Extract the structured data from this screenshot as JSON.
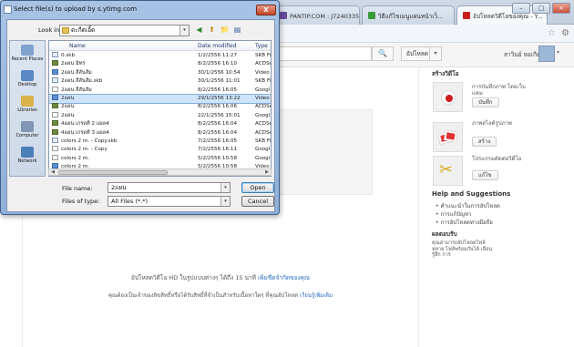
{
  "browser": {
    "tabs": [
      {
        "label": "PANTIP.COM : J7240335 ...",
        "icon_color": "#6b4ea0"
      },
      {
        "label": "วิธีแก้ไขเมนูแผ่นหน้าเว็...",
        "icon_color": "#3a9a3a"
      },
      {
        "label": "อัปโหลดวิดีโอของคุณ - Y...",
        "icon_color": "#cc1c1c"
      }
    ],
    "tab_close": "×",
    "win_min": "–",
    "win_max": "□",
    "win_close": "×",
    "star_icon": "☆",
    "wrench_icon": "⚙"
  },
  "youtube": {
    "search_button": "🔍",
    "upload_label": "อัปโหลด",
    "upload_dropdown": "▾",
    "username": "สาวินย์ หอเกียรติ",
    "avatar_dropdown": "▾",
    "footer_line1": "อัปโหลดวิดีโอ HD ในรูปแบบต่างๆ ได้ถึง 15 นาที",
    "footer_link1": "เพิ่มขีดจำกัดของคุณ",
    "footer_line2": "คุณต้องเป็นเจ้าของลิขสิทธิ์หรือได้รับสิทธิ์ที่จำเป็นสำหรับเนื้อหาใดๆ ที่คุณอัปโหลด",
    "footer_link2": "เรียนรู้เพิ่มเติม",
    "side": {
      "create_title": "สร้างวิดีโอ",
      "record_label": "การบันทึกภาพ โดยเว็บแคม",
      "record_button": "บันทึก",
      "photo_label": "ภาพสไลด์รูปภาพ",
      "photo_button": "สร้าง",
      "edit_label": "โปรแกรมตัดต่อวิดีโอ",
      "edit_button": "แก้ไข",
      "help_title": "Help and Suggestions",
      "help_items": [
        "คำแนะนำในการอัปโหลด",
        "การแก้ปัญหา",
        "การอัปโหลดทางมือถือ"
      ],
      "feedback_title": "ผลตอบรับ",
      "feedback_text": "คุณสามารถอัปโหลดไฟล์หลาย ไฟล์พร้อมกันได้ เลือนรู้สึก การ"
    }
  },
  "dialog": {
    "title": "Select file(s) to upload by s.ytimg.com",
    "close": "X",
    "look_in_label": "Look in:",
    "look_in_value": "ตะกีดเอิ้ด",
    "look_in_dropdown": "▾",
    "toolbar_icons": [
      "◀",
      "⬆",
      "📁",
      "▤"
    ],
    "places": [
      {
        "label": "Recent Places",
        "color": "#7fa3cf"
      },
      {
        "label": "Desktop",
        "color": "#5a88c2"
      },
      {
        "label": "Libraries",
        "color": "#d9b24a"
      },
      {
        "label": "Computer",
        "color": "#8096b3"
      },
      {
        "label": "Network",
        "color": "#4b7fb8"
      }
    ],
    "columns": {
      "name": "Name",
      "date": "Date modified",
      "type": "Type"
    },
    "files": [
      {
        "name": "0.skb",
        "date": "1/2/2556 11:27",
        "type": "SKB Fil",
        "icon": "skb"
      },
      {
        "name": "2แผน มิทร",
        "date": "8/2/2556 16:10",
        "type": "ACDSe",
        "icon": "acd"
      },
      {
        "name": "2แผน สีสันส้ม",
        "date": "30/1/2556 10:54",
        "type": "Video",
        "icon": "vid"
      },
      {
        "name": "2แผน สีสันส้ม.skb",
        "date": "30/1/2556 11:01",
        "type": "SKB Fil",
        "icon": "skb"
      },
      {
        "name": "2แผน สีสันส้ม",
        "date": "8/2/2556 16:05",
        "type": "Googl",
        "icon": "goo"
      },
      {
        "name": "2แผน",
        "date": "29/1/2556 13:22",
        "type": "Video",
        "icon": "vid",
        "selected": true
      },
      {
        "name": "2แผน",
        "date": "8/2/2556 16:06",
        "type": "ACDSe",
        "icon": "acd"
      },
      {
        "name": "2แผน",
        "date": "22/1/2556 15:01",
        "type": "Googl",
        "icon": "goo"
      },
      {
        "name": "4แผน เกรดที่ 2 แผล4",
        "date": "8/2/2556 16:04",
        "type": "ACDSe",
        "icon": "acd"
      },
      {
        "name": "4แผน เกรดที่ 3 แผล4",
        "date": "8/2/2556 16:04",
        "type": "ACDSe",
        "icon": "acd"
      },
      {
        "name": "colors 2 m. - Copy.skb",
        "date": "7/2/2556 16:05",
        "type": "SKB Fil",
        "icon": "skb"
      },
      {
        "name": "colors 2 m. - Copy",
        "date": "7/2/2556 16:11",
        "type": "Googl",
        "icon": "goo"
      },
      {
        "name": "colors 2 m.",
        "date": "5/2/2556 10:58",
        "type": "Googl",
        "icon": "goo"
      },
      {
        "name": "colors 2 m.",
        "date": "5/2/2556 10:58",
        "type": "Video",
        "icon": "vid"
      }
    ],
    "file_name_label": "File name:",
    "file_name_value": "2แผน",
    "file_type_label": "Files of type:",
    "file_type_value": "All Files (*.*)",
    "dropdown_glyph": "▾",
    "open_button": "Open",
    "cancel_button": "Cancel"
  }
}
